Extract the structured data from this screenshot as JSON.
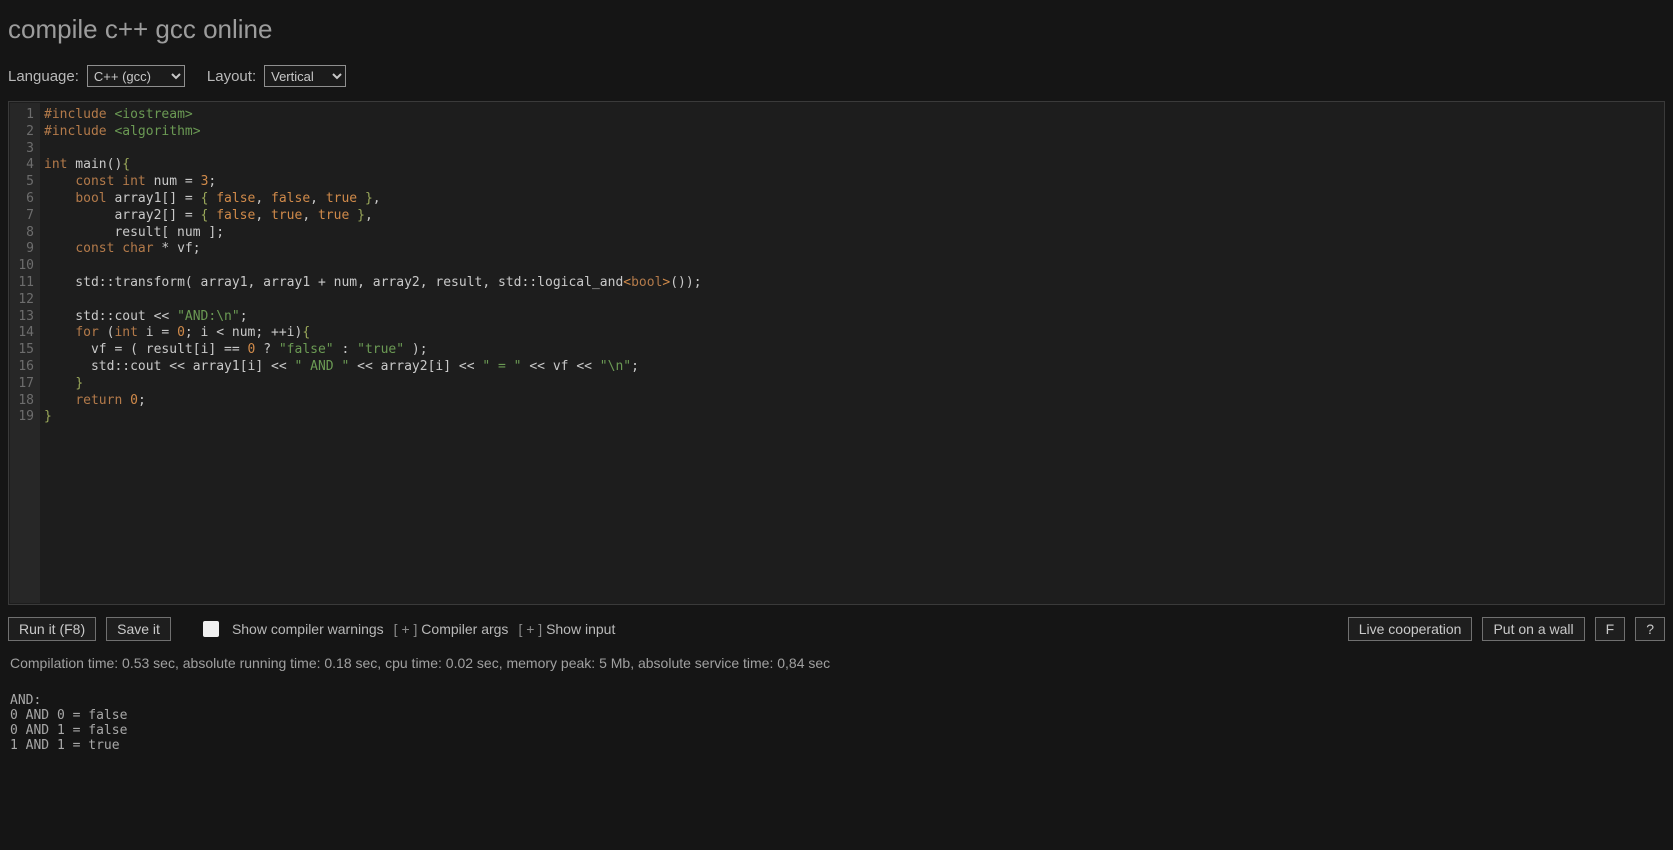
{
  "title": "compile c++ gcc online",
  "controls": {
    "language_label": "Language:",
    "language_value": "C++ (gcc)",
    "layout_label": "Layout:",
    "layout_value": "Vertical"
  },
  "editor": {
    "line_count": 19,
    "tokens": [
      [
        [
          "pp",
          "#include "
        ],
        [
          "inc",
          "<iostream>"
        ]
      ],
      [
        [
          "pp",
          "#include "
        ],
        [
          "inc",
          "<algorithm>"
        ]
      ],
      [],
      [
        [
          "kw",
          "int"
        ],
        [
          "id",
          " main"
        ],
        [
          "punc",
          "()"
        ],
        [
          "br",
          "{"
        ]
      ],
      [
        [
          "id",
          "    "
        ],
        [
          "kw",
          "const"
        ],
        [
          "id",
          " "
        ],
        [
          "kw",
          "int"
        ],
        [
          "id",
          " num "
        ],
        [
          "op",
          "="
        ],
        [
          "id",
          " "
        ],
        [
          "num",
          "3"
        ],
        [
          "punc",
          ";"
        ]
      ],
      [
        [
          "id",
          "    "
        ],
        [
          "kw",
          "bool"
        ],
        [
          "id",
          " array1"
        ],
        [
          "punc",
          "[]"
        ],
        [
          "id",
          " "
        ],
        [
          "op",
          "="
        ],
        [
          "id",
          " "
        ],
        [
          "br",
          "{"
        ],
        [
          "id",
          " "
        ],
        [
          "const",
          "false"
        ],
        [
          "punc",
          ","
        ],
        [
          "id",
          " "
        ],
        [
          "const",
          "false"
        ],
        [
          "punc",
          ","
        ],
        [
          "id",
          " "
        ],
        [
          "const",
          "true"
        ],
        [
          "id",
          " "
        ],
        [
          "br",
          "}"
        ],
        [
          "punc",
          ","
        ]
      ],
      [
        [
          "id",
          "         array2"
        ],
        [
          "punc",
          "[]"
        ],
        [
          "id",
          " "
        ],
        [
          "op",
          "="
        ],
        [
          "id",
          " "
        ],
        [
          "br",
          "{"
        ],
        [
          "id",
          " "
        ],
        [
          "const",
          "false"
        ],
        [
          "punc",
          ","
        ],
        [
          "id",
          " "
        ],
        [
          "const",
          "true"
        ],
        [
          "punc",
          ","
        ],
        [
          "id",
          " "
        ],
        [
          "const",
          "true"
        ],
        [
          "id",
          " "
        ],
        [
          "br",
          "}"
        ],
        [
          "punc",
          ","
        ]
      ],
      [
        [
          "id",
          "         result"
        ],
        [
          "punc",
          "["
        ],
        [
          "id",
          " num "
        ],
        [
          "punc",
          "]"
        ],
        [
          "punc",
          ";"
        ]
      ],
      [
        [
          "id",
          "    "
        ],
        [
          "kw",
          "const"
        ],
        [
          "id",
          " "
        ],
        [
          "kw",
          "char"
        ],
        [
          "id",
          " "
        ],
        [
          "op",
          "*"
        ],
        [
          "id",
          " vf"
        ],
        [
          "punc",
          ";"
        ]
      ],
      [],
      [
        [
          "id",
          "    std"
        ],
        [
          "op",
          "::"
        ],
        [
          "id",
          "transform"
        ],
        [
          "punc",
          "("
        ],
        [
          "id",
          " array1"
        ],
        [
          "punc",
          ","
        ],
        [
          "id",
          " array1 "
        ],
        [
          "op",
          "+"
        ],
        [
          "id",
          " num"
        ],
        [
          "punc",
          ","
        ],
        [
          "id",
          " array2"
        ],
        [
          "punc",
          ","
        ],
        [
          "id",
          " result"
        ],
        [
          "punc",
          ","
        ],
        [
          "id",
          " std"
        ],
        [
          "op",
          "::"
        ],
        [
          "id",
          "logical_and"
        ],
        [
          "tmpl",
          "<"
        ],
        [
          "kw",
          "bool"
        ],
        [
          "tmpl",
          ">"
        ],
        [
          "punc",
          "()"
        ],
        [
          "punc",
          ")"
        ],
        [
          "punc",
          ";"
        ]
      ],
      [],
      [
        [
          "id",
          "    std"
        ],
        [
          "op",
          "::"
        ],
        [
          "id",
          "cout "
        ],
        [
          "op",
          "<<"
        ],
        [
          "id",
          " "
        ],
        [
          "str",
          "\"AND:\\n\""
        ],
        [
          "punc",
          ";"
        ]
      ],
      [
        [
          "id",
          "    "
        ],
        [
          "kw",
          "for"
        ],
        [
          "id",
          " "
        ],
        [
          "punc",
          "("
        ],
        [
          "kw",
          "int"
        ],
        [
          "id",
          " i "
        ],
        [
          "op",
          "="
        ],
        [
          "id",
          " "
        ],
        [
          "num",
          "0"
        ],
        [
          "punc",
          ";"
        ],
        [
          "id",
          " i "
        ],
        [
          "op",
          "<"
        ],
        [
          "id",
          " num"
        ],
        [
          "punc",
          ";"
        ],
        [
          "id",
          " "
        ],
        [
          "op",
          "++"
        ],
        [
          "id",
          "i"
        ],
        [
          "punc",
          ")"
        ],
        [
          "br",
          "{"
        ]
      ],
      [
        [
          "id",
          "      vf "
        ],
        [
          "op",
          "="
        ],
        [
          "id",
          " "
        ],
        [
          "punc",
          "("
        ],
        [
          "id",
          " result"
        ],
        [
          "punc",
          "["
        ],
        [
          "id",
          "i"
        ],
        [
          "punc",
          "]"
        ],
        [
          "id",
          " "
        ],
        [
          "op",
          "=="
        ],
        [
          "id",
          " "
        ],
        [
          "num",
          "0"
        ],
        [
          "id",
          " "
        ],
        [
          "op",
          "?"
        ],
        [
          "id",
          " "
        ],
        [
          "str",
          "\"false\""
        ],
        [
          "id",
          " "
        ],
        [
          "op",
          ":"
        ],
        [
          "id",
          " "
        ],
        [
          "str",
          "\"true\""
        ],
        [
          "id",
          " "
        ],
        [
          "punc",
          ")"
        ],
        [
          "punc",
          ";"
        ]
      ],
      [
        [
          "id",
          "      std"
        ],
        [
          "op",
          "::"
        ],
        [
          "id",
          "cout "
        ],
        [
          "op",
          "<<"
        ],
        [
          "id",
          " array1"
        ],
        [
          "punc",
          "["
        ],
        [
          "id",
          "i"
        ],
        [
          "punc",
          "]"
        ],
        [
          "id",
          " "
        ],
        [
          "op",
          "<<"
        ],
        [
          "id",
          " "
        ],
        [
          "str",
          "\" AND \""
        ],
        [
          "id",
          " "
        ],
        [
          "op",
          "<<"
        ],
        [
          "id",
          " array2"
        ],
        [
          "punc",
          "["
        ],
        [
          "id",
          "i"
        ],
        [
          "punc",
          "]"
        ],
        [
          "id",
          " "
        ],
        [
          "op",
          "<<"
        ],
        [
          "id",
          " "
        ],
        [
          "str",
          "\" = \""
        ],
        [
          "id",
          " "
        ],
        [
          "op",
          "<<"
        ],
        [
          "id",
          " vf "
        ],
        [
          "op",
          "<<"
        ],
        [
          "id",
          " "
        ],
        [
          "str",
          "\"\\n\""
        ],
        [
          "punc",
          ";"
        ]
      ],
      [
        [
          "id",
          "    "
        ],
        [
          "br",
          "}"
        ]
      ],
      [
        [
          "id",
          "    "
        ],
        [
          "kw",
          "return"
        ],
        [
          "id",
          " "
        ],
        [
          "num",
          "0"
        ],
        [
          "punc",
          ";"
        ]
      ],
      [
        [
          "br",
          "}"
        ]
      ]
    ]
  },
  "toolbar": {
    "run_label": "Run it (F8)",
    "save_label": "Save it",
    "show_warnings_label": "Show compiler warnings",
    "compiler_args_label": "Compiler args",
    "show_input_label": "Show input",
    "expand_glyph": "[ + ]",
    "live_coop_label": "Live cooperation",
    "put_wall_label": "Put on a wall",
    "fullscreen_label": "F",
    "help_label": "?"
  },
  "status": "Compilation time: 0.53 sec, absolute running time: 0.18 sec, cpu time: 0.02 sec, memory peak: 5 Mb, absolute service time: 0,84 sec",
  "output": "AND:\n0 AND 0 = false\n0 AND 1 = false\n1 AND 1 = true"
}
